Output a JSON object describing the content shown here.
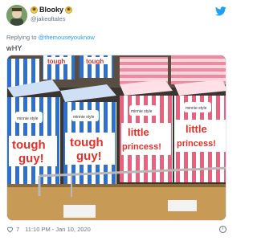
{
  "tweet": {
    "display_name": "Blooky",
    "handle": "@jakeoftales",
    "reply_prefix": "Replying to",
    "reply_to": "@themouseyouknow",
    "text": "wHY",
    "like_count": "7",
    "time": "11:10 PM",
    "date": "Jan 10, 2020",
    "separator": " - ",
    "icons": [
      "avatar",
      "twitter-bird-icon",
      "heart-icon",
      "info-icon"
    ]
  },
  "photo": {
    "blue_box_label_line1": "tough",
    "blue_box_label_line2": "guy!",
    "blue_box_brand": "minnie style",
    "pink_box_label_line1": "little",
    "pink_box_label_line2": "princess!",
    "pink_box_brand": "minnie style",
    "colors": {
      "blue_stripe": "#2f6fd0",
      "pink_stripe": "#e9617d",
      "label_red": "#e0312a",
      "shelf_wood": "#c79a55"
    }
  }
}
